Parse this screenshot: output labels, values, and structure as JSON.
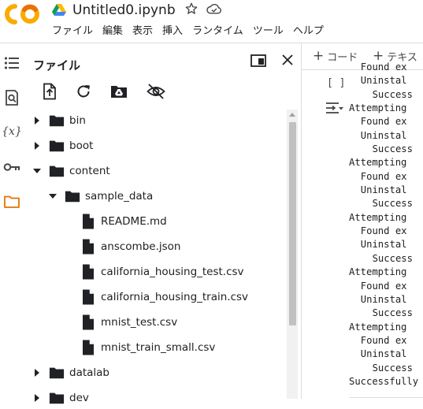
{
  "header": {
    "notebook_title": "Untitled0.ipynb",
    "logo_text": "CO",
    "menu": [
      "ファイル",
      "編集",
      "表示",
      "挿入",
      "ランタイム",
      "ツール",
      "ヘルプ"
    ]
  },
  "rail": {
    "items": [
      {
        "name": "table-of-contents-icon"
      },
      {
        "name": "find-replace-icon"
      },
      {
        "name": "variables-icon",
        "label": "{x}"
      },
      {
        "name": "secrets-key-icon"
      },
      {
        "name": "files-folder-icon",
        "active": true
      }
    ]
  },
  "panel": {
    "title": "ファイル",
    "toolbar": [
      "upload-file-icon",
      "refresh-icon",
      "mount-drive-icon",
      "hide-files-icon"
    ],
    "tree": [
      {
        "label": "bin",
        "type": "folder",
        "depth": 0,
        "expanded": false
      },
      {
        "label": "boot",
        "type": "folder",
        "depth": 0,
        "expanded": false
      },
      {
        "label": "content",
        "type": "folder",
        "depth": 0,
        "expanded": true
      },
      {
        "label": "sample_data",
        "type": "folder",
        "depth": 1,
        "expanded": true
      },
      {
        "label": "README.md",
        "type": "file",
        "depth": 2
      },
      {
        "label": "anscombe.json",
        "type": "file",
        "depth": 2
      },
      {
        "label": "california_housing_test.csv",
        "type": "file",
        "depth": 2
      },
      {
        "label": "california_housing_train.csv",
        "type": "file",
        "depth": 2
      },
      {
        "label": "mnist_test.csv",
        "type": "file",
        "depth": 2
      },
      {
        "label": "mnist_train_small.csv",
        "type": "file",
        "depth": 2
      },
      {
        "label": "datalab",
        "type": "folder",
        "depth": 0,
        "expanded": false
      },
      {
        "label": "dev",
        "type": "folder",
        "depth": 0,
        "expanded": false
      }
    ]
  },
  "notebook": {
    "add_code": "コード",
    "add_text": "テキス",
    "cell_brackets": "[ ]",
    "output_lines": [
      {
        "text": "Found ex",
        "indent": 2
      },
      {
        "text": "Uninstal",
        "indent": 2
      },
      {
        "text": "Success",
        "indent": 4
      },
      {
        "text": "Attempting",
        "indent": 0
      },
      {
        "text": "Found ex",
        "indent": 2
      },
      {
        "text": "Uninstal",
        "indent": 2
      },
      {
        "text": "Success",
        "indent": 4
      },
      {
        "text": "Attempting",
        "indent": 0
      },
      {
        "text": "Found ex",
        "indent": 2
      },
      {
        "text": "Uninstal",
        "indent": 2
      },
      {
        "text": "Success",
        "indent": 4
      },
      {
        "text": "Attempting",
        "indent": 0
      },
      {
        "text": "Found ex",
        "indent": 2
      },
      {
        "text": "Uninstal",
        "indent": 2
      },
      {
        "text": "Success",
        "indent": 4
      },
      {
        "text": "Attempting",
        "indent": 0
      },
      {
        "text": "Found ex",
        "indent": 2
      },
      {
        "text": "Uninstal",
        "indent": 2
      },
      {
        "text": "Success",
        "indent": 4
      },
      {
        "text": "Attempting",
        "indent": 0
      },
      {
        "text": "Found ex",
        "indent": 2
      },
      {
        "text": "Uninstal",
        "indent": 2
      },
      {
        "text": "Success",
        "indent": 4
      },
      {
        "text": "Successfully",
        "indent": 0
      }
    ]
  },
  "colors": {
    "logo_orange": "#f9ab00",
    "logo_dark_orange": "#e8710a",
    "active_folder": "#e37400",
    "text": "#202124",
    "icon": "#444746"
  }
}
